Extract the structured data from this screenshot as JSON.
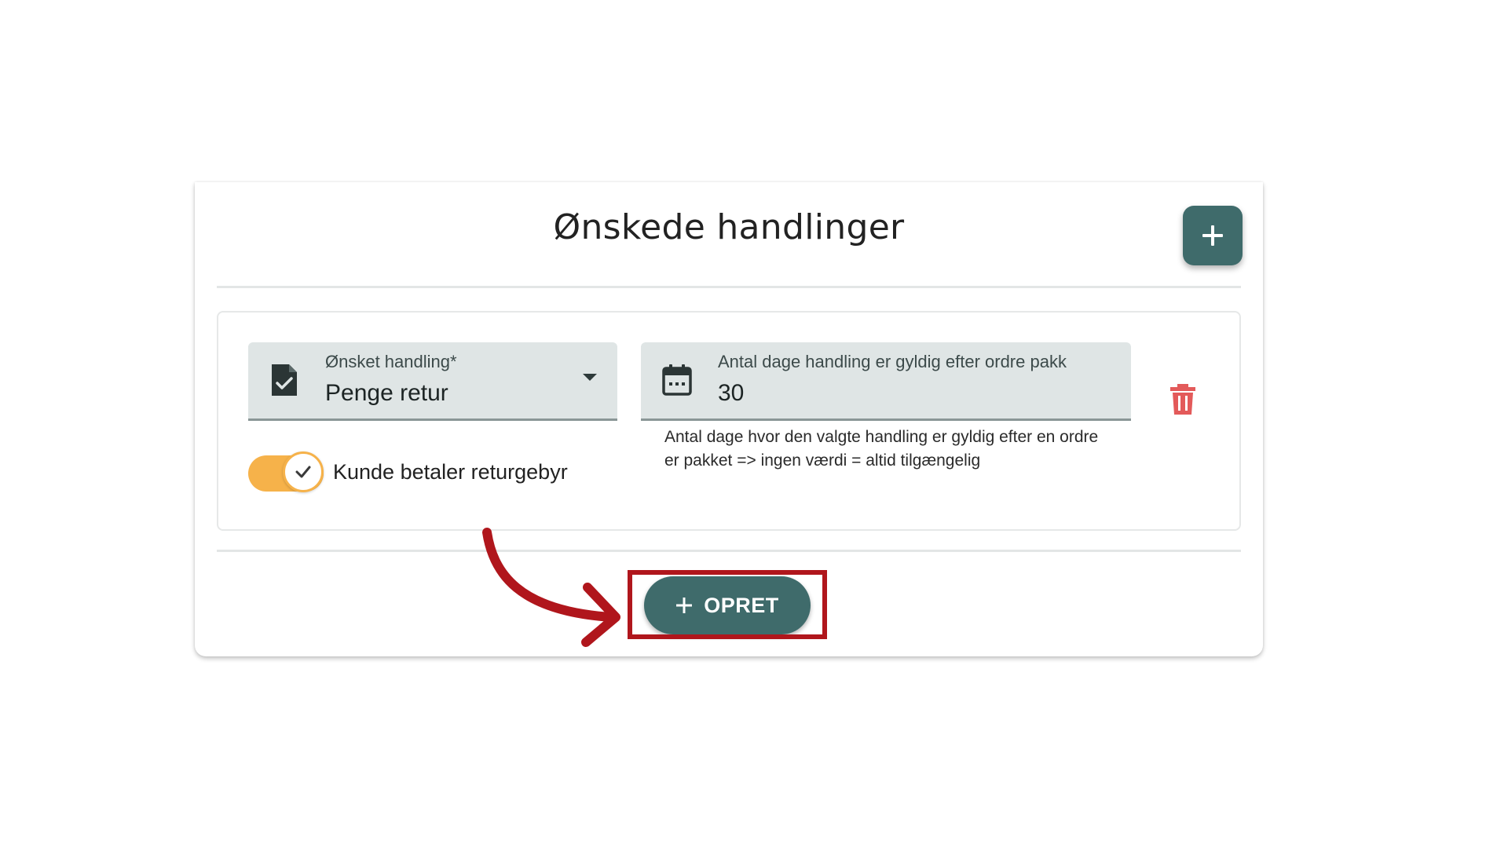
{
  "card": {
    "title": "Ønskede handlinger",
    "add_button_icon": "plus-icon"
  },
  "action": {
    "select_field": {
      "icon": "document-check-icon",
      "label": "Ønsket handling*",
      "value": "Penge retur"
    },
    "days_field": {
      "icon": "calendar-icon",
      "label": "Antal dage handling er gyldig efter ordre pakk",
      "value": "30",
      "helper_text": "Antal dage hvor den valgte handling er gyldig efter en ordre er pakket => ingen værdi = altid tilgængelig"
    },
    "toggle": {
      "label": "Kunde betaler returgebyr",
      "checked": true
    },
    "delete_icon": "trash-icon"
  },
  "footer": {
    "create_button_label": "OPRET"
  },
  "colors": {
    "primary": "#3f6b6b",
    "toggle_on": "#f6b24a",
    "delete": "#e35a5a",
    "annotation": "#b0161c",
    "field_bg": "#dfe5e5"
  }
}
